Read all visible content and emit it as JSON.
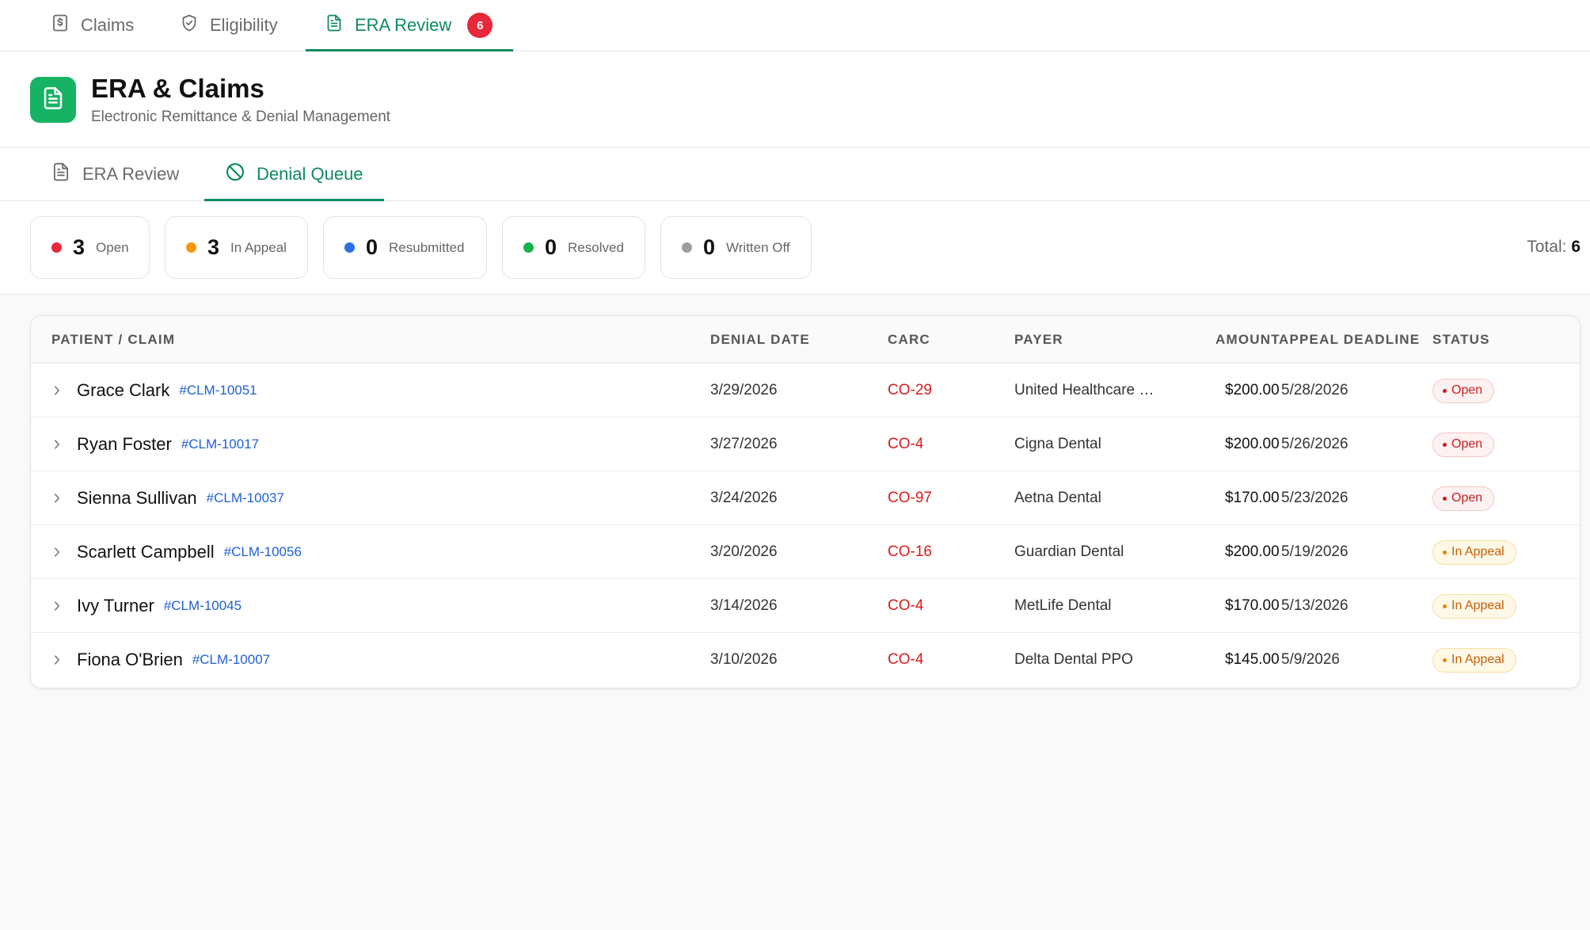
{
  "top_tabs": [
    {
      "label": "Claims",
      "icon": "dollar-document-icon"
    },
    {
      "label": "Eligibility",
      "icon": "shield-check-icon"
    },
    {
      "label": "ERA Review",
      "icon": "document-icon",
      "badge": "6",
      "active": true
    }
  ],
  "header": {
    "title": "ERA & Claims",
    "subtitle": "Electronic Remittance & Denial Management",
    "logo_icon": "document-icon",
    "logo_color": "#16b364"
  },
  "sub_tabs": [
    {
      "label": "ERA Review",
      "icon": "document-icon"
    },
    {
      "label": "Denial Queue",
      "icon": "ban-icon",
      "active": true
    }
  ],
  "stats": [
    {
      "count": "3",
      "label": "Open",
      "color": "#e8283b"
    },
    {
      "count": "3",
      "label": "In Appeal",
      "color": "#f5960c"
    },
    {
      "count": "0",
      "label": "Resubmitted",
      "color": "#2f6fe8"
    },
    {
      "count": "0",
      "label": "Resolved",
      "color": "#16b34a"
    },
    {
      "count": "0",
      "label": "Written Off",
      "color": "#9e9e9e"
    }
  ],
  "total": {
    "label": "Total:",
    "value": "6"
  },
  "table": {
    "headers": {
      "patient": "PATIENT / CLAIM",
      "denial_date": "DENIAL DATE",
      "carc": "CARC",
      "payer": "PAYER",
      "amount": "AMOUNT",
      "deadline": "APPEAL DEADLINE",
      "status": "STATUS"
    },
    "rows": [
      {
        "patient": "Grace Clark",
        "claim": "#CLM-10051",
        "date": "3/29/2026",
        "carc": "CO-29",
        "payer": "United Healthcare …",
        "amount": "$200.00",
        "deadline": "5/28/2026",
        "status": "Open"
      },
      {
        "patient": "Ryan Foster",
        "claim": "#CLM-10017",
        "date": "3/27/2026",
        "carc": "CO-4",
        "payer": "Cigna Dental",
        "amount": "$200.00",
        "deadline": "5/26/2026",
        "status": "Open"
      },
      {
        "patient": "Sienna Sullivan",
        "claim": "#CLM-10037",
        "date": "3/24/2026",
        "carc": "CO-97",
        "payer": "Aetna Dental",
        "amount": "$170.00",
        "deadline": "5/23/2026",
        "status": "Open"
      },
      {
        "patient": "Scarlett Campbell",
        "claim": "#CLM-10056",
        "date": "3/20/2026",
        "carc": "CO-16",
        "payer": "Guardian Dental",
        "amount": "$200.00",
        "deadline": "5/19/2026",
        "status": "In Appeal"
      },
      {
        "patient": "Ivy Turner",
        "claim": "#CLM-10045",
        "date": "3/14/2026",
        "carc": "CO-4",
        "payer": "MetLife Dental",
        "amount": "$170.00",
        "deadline": "5/13/2026",
        "status": "In Appeal"
      },
      {
        "patient": "Fiona O'Brien",
        "claim": "#CLM-10007",
        "date": "3/10/2026",
        "carc": "CO-4",
        "payer": "Delta Dental PPO",
        "amount": "$145.00",
        "deadline": "5/9/2026",
        "status": "In Appeal"
      }
    ]
  }
}
